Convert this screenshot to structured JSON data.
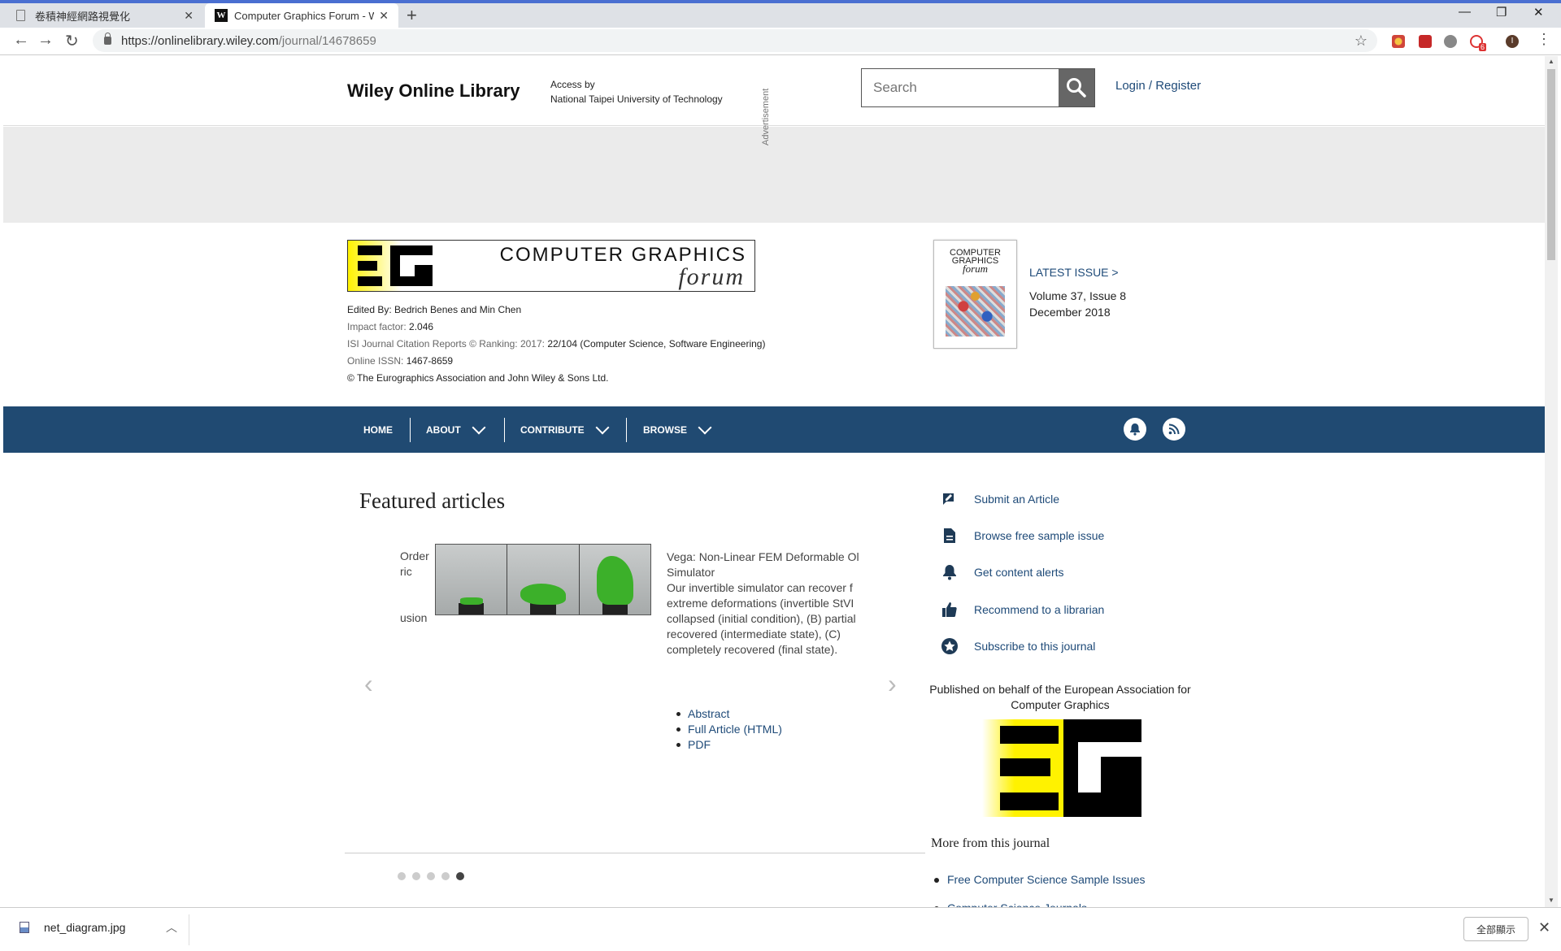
{
  "browser": {
    "tabs": [
      {
        "title": "卷積神經網路視覺化",
        "active": false
      },
      {
        "title": "Computer Graphics Forum - W",
        "active": true
      }
    ],
    "url_prefix": "https://onlinelibrary.wiley.com",
    "url_path": "/journal/14678659",
    "extension_badge": "6",
    "profile_initial": "I",
    "accent": "#4a6fd1"
  },
  "header": {
    "brand": "Wiley Online Library",
    "access_by": "Access by",
    "institution": "National Taipei University of Technology",
    "search_placeholder": "Search",
    "login": "Login",
    "register": "Register"
  },
  "ad": {
    "label": "Advertisement"
  },
  "journal": {
    "banner_title": "COMPUTER GRAPHICS",
    "banner_sub": "forum",
    "edited_label": "Edited By: ",
    "editors": "Bedrich Benes and Min Chen",
    "impact_label": "Impact factor: ",
    "impact": "2.046",
    "ranking_label": "ISI Journal Citation Reports © Ranking: 2017: ",
    "ranking": "22/104 (Computer Science, Software Engineering)",
    "issn_label": "Online ISSN: ",
    "issn": "1467-8659",
    "copyright": "© The Eurographics Association and John Wiley & Sons Ltd.",
    "cover_title_1": "COMPUTER",
    "cover_title_2": "GRAPHICS",
    "cover_title_3": "forum",
    "latest_issue": "LATEST ISSUE >",
    "volume": "Volume 37, Issue 8",
    "date": "December 2018"
  },
  "nav": {
    "home": "HOME",
    "about": "ABOUT",
    "contribute": "CONTRIBUTE",
    "browse": "BROWSE",
    "brand_color": "#204a72"
  },
  "featured": {
    "heading": "Featured articles",
    "prev_fragment": [
      "Order",
      "ric",
      "usion"
    ],
    "title_lines": [
      "Vega: Non-Linear FEM Deformable Ol",
      "Simulator"
    ],
    "desc_lines": [
      "Our invertible simulator can recover f",
      "extreme deformations (invertible StVI",
      "collapsed (initial condition), (B) partial",
      "recovered (intermediate state), (C)",
      "completely recovered (final state)."
    ],
    "links": [
      "Abstract",
      "Full Article (HTML)",
      "PDF"
    ],
    "slide_count": 5,
    "active_slide": 5
  },
  "sidebar": {
    "links": [
      {
        "label": "Submit an Article",
        "icon": "edit-icon"
      },
      {
        "label": "Browse free sample issue",
        "icon": "document-icon"
      },
      {
        "label": "Get content alerts",
        "icon": "bell-icon"
      },
      {
        "label": "Recommend to a librarian",
        "icon": "thumbs-up-icon"
      },
      {
        "label": "Subscribe to this journal",
        "icon": "star-badge-icon"
      }
    ],
    "published_on_behalf": "Published on behalf of the European Association for Computer Graphics",
    "more_heading": "More from this journal",
    "more_links": [
      "Free Computer Science Sample Issues",
      "Computer Science Journals"
    ]
  },
  "downloads": {
    "file": "net_diagram.jpg",
    "show_all": "全部顯示"
  }
}
